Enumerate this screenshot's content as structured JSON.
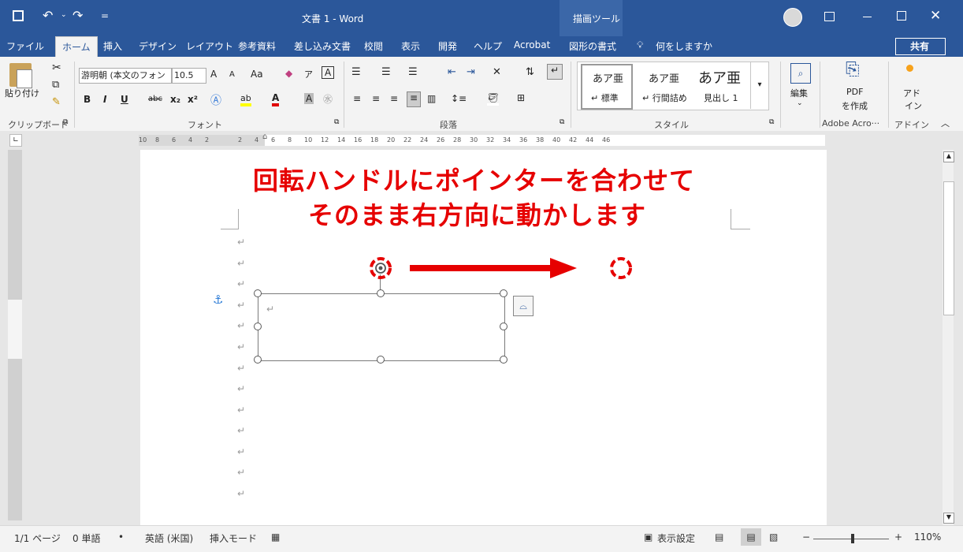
{
  "title_bar": {
    "title": "文書 1  -  Word",
    "context_tool": "描画ツール",
    "qat_save": "save-icon",
    "qat_undo": "undo-icon",
    "qat_redo": "redo-icon",
    "qat_more": "="
  },
  "tabs": {
    "file": "ファイル",
    "home": "ホーム",
    "insert": "挿入",
    "design": "デザイン",
    "layout": "レイアウト",
    "references": "参考資料",
    "mailings": "差し込み文書",
    "review": "校閲",
    "view": "表示",
    "developer": "開発",
    "help": "ヘルプ",
    "acrobat": "Acrobat",
    "shape_format": "図形の書式",
    "tell_me": "何をしますか",
    "share": "共有"
  },
  "ribbon": {
    "clipboard_label": "クリップボード",
    "paste_label": "貼り付け",
    "font_label": "フォント",
    "font_name": "游明朝 (本文のフォン",
    "font_size": "10.5",
    "paragraph_label": "段落",
    "styles_label": "スタイル",
    "style_1_sample": "あア亜",
    "style_1_name": "↵ 標準",
    "style_2_sample": "あア亜",
    "style_2_name": "↵ 行間詰め",
    "style_3_sample": "あア亜",
    "style_3_name": "見出し 1",
    "edit_label": "編集",
    "pdf_line1": "PDF",
    "pdf_line2": "を作成",
    "adobe_label": "Adobe Acro···",
    "addin_line1": "アド",
    "addin_line2": "イン",
    "addin_label": "アドイン",
    "bold": "B",
    "italic": "I",
    "underline": "U",
    "strike": "abc",
    "font_grow": "A",
    "font_shrink": "A",
    "case": "Aa"
  },
  "ruler": {
    "labels": [
      "10",
      "8",
      "6",
      "4",
      "2",
      "",
      "2",
      "4",
      "6",
      "8",
      "10",
      "12",
      "14",
      "16",
      "18",
      "20",
      "22",
      "24",
      "26",
      "28",
      "30",
      "32",
      "34",
      "36",
      "38",
      "40",
      "42",
      "44",
      "46"
    ]
  },
  "annotation": {
    "line1": "回転ハンドルにポインターを合わせて",
    "line2": "そのまま右方向に動かします"
  },
  "status": {
    "page": "1/1 ページ",
    "words": "0 単語",
    "language": "英語 (米国)",
    "mode": "挿入モード",
    "display": "表示設定",
    "zoom": "110%",
    "zoom_minus": "−",
    "zoom_plus": "+"
  },
  "colors": {
    "title_bar": "#2b579a",
    "annotation": "#e60000"
  }
}
